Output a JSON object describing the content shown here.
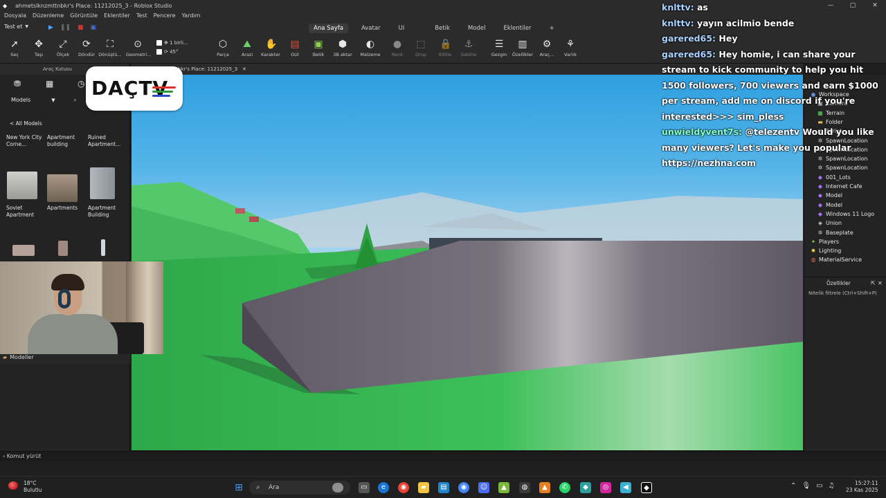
{
  "window": {
    "title": "ahmetslknzmttnbkr's Place: 11212025_3 - Roblox Studio",
    "controls": [
      "—",
      "▢",
      "✕"
    ]
  },
  "menu": [
    "Dosyala",
    "Düzenleme",
    "Görüntüle",
    "Eklentiler",
    "Test",
    "Pencere",
    "Yardım"
  ],
  "ribbon": {
    "test_select": "Test et",
    "tabs": [
      "Ana Sayfa",
      "Avatar",
      "UI",
      "Betik",
      "Model",
      "Eklentiler",
      "+"
    ],
    "active_tab": "Ana Sayfa",
    "tools": [
      {
        "label": "Seç",
        "icon": "➚"
      },
      {
        "label": "Taşı",
        "icon": "✥"
      },
      {
        "label": "Ölçek",
        "icon": "⤢"
      },
      {
        "label": "Döndür",
        "icon": "⟳"
      },
      {
        "label": "Dönüştü...",
        "icon": "⛶"
      },
      {
        "label": "Geometri...",
        "icon": "⊙"
      },
      {
        "label": "Parça",
        "icon": "⬡"
      },
      {
        "label": "Arazi",
        "icon": "⛰"
      },
      {
        "label": "Karakter",
        "icon": "✋"
      },
      {
        "label": "GUI",
        "icon": "▤"
      },
      {
        "label": "Betik",
        "icon": "▣"
      },
      {
        "label": "3B aktar",
        "icon": "⬢"
      },
      {
        "label": "Malzeme",
        "icon": "◐"
      },
      {
        "label": "Renk",
        "icon": "●"
      },
      {
        "label": "Grup",
        "icon": "⬚"
      },
      {
        "label": "Kilitle",
        "icon": "🔒"
      },
      {
        "label": "Sabitle",
        "icon": "⚓"
      },
      {
        "label": "Gezgin",
        "icon": "☰"
      },
      {
        "label": "Özellikler",
        "icon": "▥"
      },
      {
        "label": "Araç...",
        "icon": "⚙"
      },
      {
        "label": "Varlık",
        "icon": "⚘"
      }
    ],
    "snap_move": "1 birli...",
    "snap_rotate": "45°"
  },
  "left_panel": {
    "header": "Araç Kutusu",
    "category": "Models",
    "breadcrumb": "< All Models",
    "top_row": [
      "New York City Corne...",
      "Apartment building",
      "Ruined Apartment..."
    ],
    "items": [
      {
        "label": "Soviet Apartment",
        "color": "#b9b9b6"
      },
      {
        "label": "Apartments",
        "color": "#8f8373"
      },
      {
        "label": "Apartment Building",
        "color": "#9aa0a6"
      }
    ],
    "footer": "Modeller"
  },
  "viewport_tab": {
    "title": "ahmetslknzmttnbkr's Place: 11212025_3",
    "close": "✕"
  },
  "logo_text": "DAÇTV",
  "chat": [
    {
      "user": "knlttv:",
      "msg": "as",
      "user_color": "u1"
    },
    {
      "user": "knlttv:",
      "msg": "yayın acilmio bende",
      "user_color": "u1"
    },
    {
      "user": "garered65:",
      "msg": "Hey",
      "user_color": "u1"
    },
    {
      "user": "garered65:",
      "msg": "Hey homie, i can share your stream to kick community to help you hit 1500 followers, 700 viewers and earn $1000 per stream, add me on discord if you're interested>>> sim_pless",
      "user_color": "u1"
    },
    {
      "user": "unwieldyvent7s:",
      "msg": "@telezentv Would you like many viewers? Let's make you popular https://nezhna.com",
      "user_color": "u3"
    }
  ],
  "explorer": [
    {
      "label": "Workspace",
      "icon": "◉",
      "color": "#6fa8ff",
      "indent": 0
    },
    {
      "label": "Camera",
      "icon": "▣",
      "color": "#cfcfcf",
      "indent": 1
    },
    {
      "label": "Terrain",
      "icon": "▦",
      "color": "#5fcf5f",
      "indent": 1
    },
    {
      "label": "Folder",
      "icon": "▬",
      "color": "#e7c15a",
      "indent": 1
    },
    {
      "label": "Script",
      "icon": "▤",
      "color": "#cfcfcf",
      "indent": 1
    },
    {
      "label": "SpawnLocation",
      "icon": "✲",
      "color": "#cfcfcf",
      "indent": 1
    },
    {
      "label": "SpawnLocation",
      "icon": "✲",
      "color": "#cfcfcf",
      "indent": 1
    },
    {
      "label": "SpawnLocation",
      "icon": "✲",
      "color": "#cfcfcf",
      "indent": 1
    },
    {
      "label": "SpawnLocation",
      "icon": "✲",
      "color": "#cfcfcf",
      "indent": 1
    },
    {
      "label": "001_Lots",
      "icon": "◆",
      "color": "#b070ff",
      "indent": 1
    },
    {
      "label": "Internet Cafe",
      "icon": "◆",
      "color": "#b070ff",
      "indent": 1
    },
    {
      "label": "Model",
      "icon": "◆",
      "color": "#b070ff",
      "indent": 1
    },
    {
      "label": "Model",
      "icon": "◆",
      "color": "#b070ff",
      "indent": 1
    },
    {
      "label": "Windows 11 Logo",
      "icon": "◆",
      "color": "#b070ff",
      "indent": 1
    },
    {
      "label": "Union",
      "icon": "◈",
      "color": "#cfcfcf",
      "indent": 1
    },
    {
      "label": "Baseplate",
      "icon": "✲",
      "color": "#cfcfcf",
      "indent": 1
    },
    {
      "label": "Players",
      "icon": "✦",
      "color": "#7fcf4f",
      "indent": 0
    },
    {
      "label": "Lighting",
      "icon": "✹",
      "color": "#f0d040",
      "indent": 0
    },
    {
      "label": "MaterialService",
      "icon": "◍",
      "color": "#e06b5a",
      "indent": 0
    }
  ],
  "properties": {
    "header": "Özellikler",
    "filter": "Nitelik filtrele (Ctrl+Shift+P)"
  },
  "command_bar": "Komut yürüt",
  "taskbar": {
    "temp": "18°C",
    "weather": "Bulutlu",
    "search": "Ara",
    "time": "15:27:11",
    "date": "23 Kas 2025"
  }
}
